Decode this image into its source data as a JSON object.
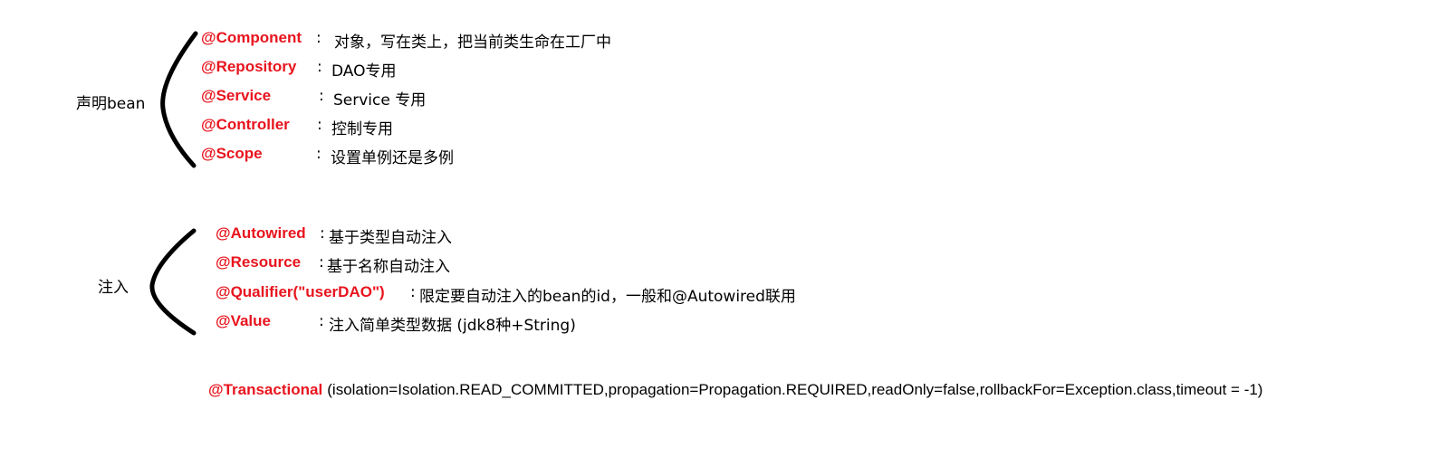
{
  "declare_group": {
    "label": "声明bean",
    "items": [
      {
        "annotation": "@Component",
        "separator": ":",
        "description": "对象，写在类上，把当前类生命在工厂中"
      },
      {
        "annotation": "@Repository",
        "separator": ":",
        "description": "DAO专用"
      },
      {
        "annotation": "@Service",
        "separator": ":",
        "description": "Service 专用"
      },
      {
        "annotation": "@Controller",
        "separator": ":",
        "description": "控制专用"
      },
      {
        "annotation": "@Scope",
        "separator": ":",
        "description": "设置单例还是多例"
      }
    ]
  },
  "inject_group": {
    "label": "注入",
    "items": [
      {
        "annotation": "@Autowired",
        "separator": ":",
        "description": "基于类型自动注入"
      },
      {
        "annotation": "@Resource",
        "separator": ":",
        "description": "基于名称自动注入"
      },
      {
        "annotation": "@Qualifier(\"userDAO\")",
        "separator": ":",
        "description": "限定要自动注入的bean的id，一般和@Autowired联用"
      },
      {
        "annotation": "@Value",
        "separator": ":",
        "description": "注入简单类型数据 (jdk8种+String)"
      }
    ]
  },
  "transactional": {
    "annotation": "@Transactional",
    "params": "(isolation=Isolation.READ_COMMITTED,propagation=Propagation.REQUIRED,readOnly=false,rollbackFor=Exception.class,timeout = -1)"
  },
  "colors": {
    "annotation": "#e8141e",
    "text": "#000000",
    "brace": "#000000"
  }
}
